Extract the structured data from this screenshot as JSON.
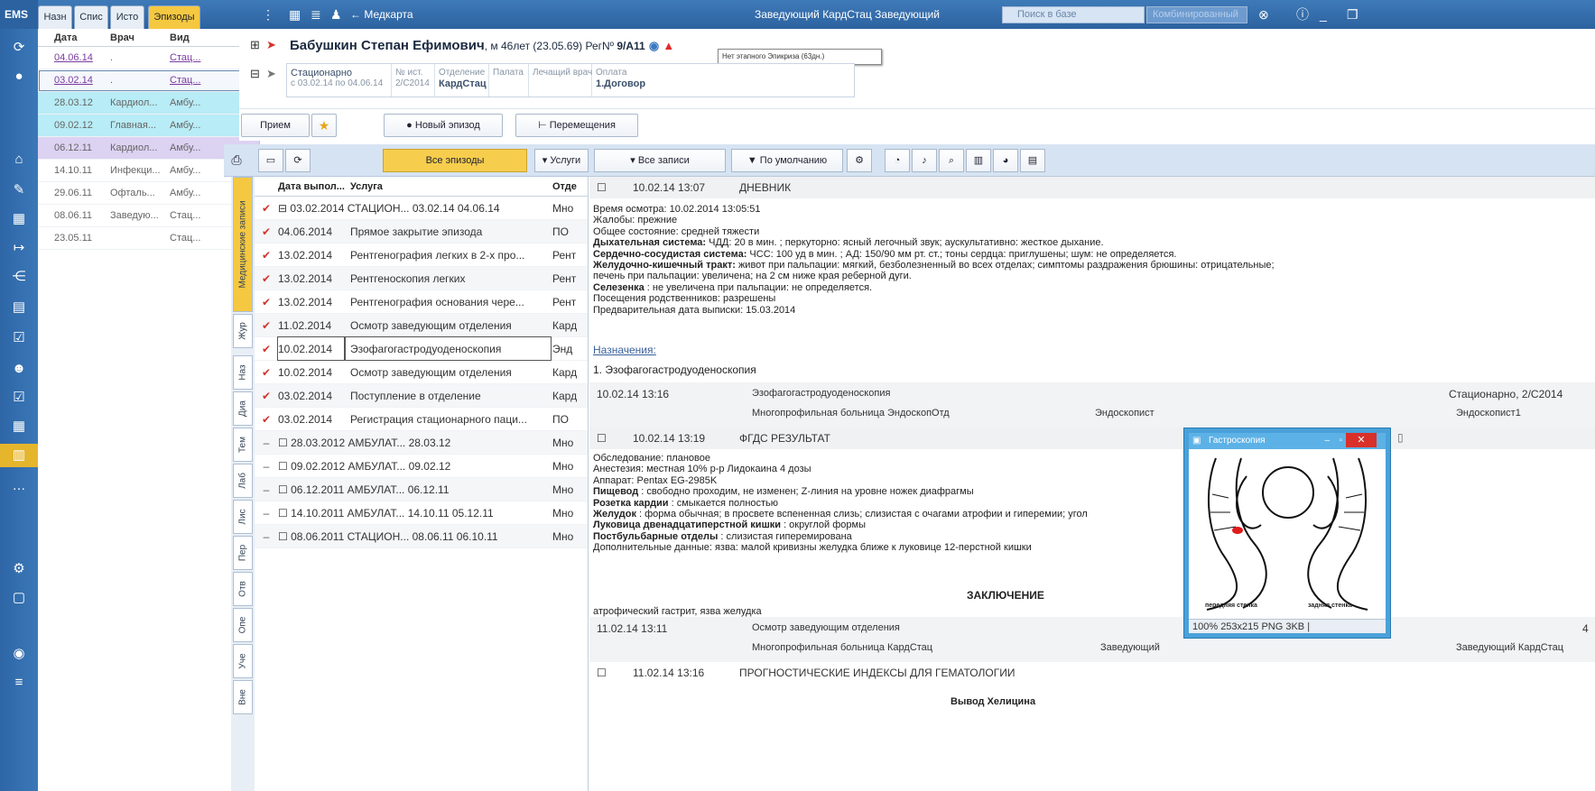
{
  "app": {
    "logo": "EMS"
  },
  "episode_tabs": [
    "Назн",
    "Спис",
    "Исто",
    "Эпизоды"
  ],
  "episode_list": {
    "headers": {
      "date": "Дата",
      "doctor": "Врач",
      "type": "Вид"
    },
    "rows": [
      {
        "date": "04.06.14",
        "doctor": ".",
        "type": "Стац..."
      },
      {
        "date": "03.02.14",
        "doctor": ".",
        "type": "Стац..."
      },
      {
        "date": "28.03.12",
        "doctor": "Кардиол...",
        "type": "Амбу..."
      },
      {
        "date": "09.02.12",
        "doctor": "Главная...",
        "type": "Амбу..."
      },
      {
        "date": "06.12.11",
        "doctor": "Кардиол...",
        "type": "Амбу..."
      },
      {
        "date": "14.10.11",
        "doctor": "Инфекци...",
        "type": "Амбу..."
      },
      {
        "date": "29.06.11",
        "doctor": "Офталь...",
        "type": "Амбу..."
      },
      {
        "date": "08.06.11",
        "doctor": "Заведую...",
        "type": "Стац..."
      },
      {
        "date": "23.05.11",
        "doctor": "",
        "type": "Стац..."
      }
    ]
  },
  "topbar": {
    "medcard": "Медкарта",
    "user": "Заведующий КардСтац Заведующий",
    "search_placeholder": "Поиск в базе",
    "combo": "Комбинированный"
  },
  "patient": {
    "name": "Бабушкин Степан Ефимович",
    "details": ", м 46лет (23.05.69) РегNº ",
    "reg": "9/А11",
    "tooltip": "Нет этапного Эпикриза (63дн.)",
    "card": {
      "type": "Стационарно",
      "period": "с 03.02.14 по 04.06.14",
      "num_label": "№ ист.",
      "num": "2/С2014",
      "dept_label": "Отделение",
      "dept": "КардСтац",
      "ward_label": "Палата",
      "doctor_label": "Лечащий врач",
      "pay_label": "Оплата",
      "pay": "1.Договор"
    }
  },
  "actions": {
    "reception": "Прием",
    "new_episode": "Новый эпизод",
    "transfers": "Перемещения"
  },
  "toolbar": {
    "all_episodes": "Все эпизоды",
    "services": "Услуги",
    "all_records": "Все записи",
    "default": "По умолчанию"
  },
  "vertical_tabs": [
    "Медицинские записи",
    "Жур",
    "Наз",
    "Диа",
    "Тем",
    "Лаб",
    "Лис",
    "Пер",
    "Отв",
    "Опе",
    "Уче",
    "Вне"
  ],
  "services": {
    "headers": {
      "date": "Дата выпол...",
      "service": "Услуга",
      "dept": "Отде"
    },
    "rows": [
      {
        "mark": "✔",
        "date": "",
        "service": "⊟ 03.02.2014  СТАЦИОН...  03.02.14   04.06.14",
        "dept": "Мно"
      },
      {
        "mark": "✔",
        "date": "04.06.2014",
        "service": "Прямое закрытие эпизода",
        "dept": "ПО"
      },
      {
        "mark": "✔",
        "date": "13.02.2014",
        "service": "Рентгенография легких в 2-х про...",
        "dept": "Рент"
      },
      {
        "mark": "✔",
        "date": "13.02.2014",
        "service": "Рентгеноскопия легких",
        "dept": "Рент"
      },
      {
        "mark": "✔",
        "date": "13.02.2014",
        "service": "Рентгенография основания чере...",
        "dept": "Рент"
      },
      {
        "mark": "✔",
        "date": "11.02.2014",
        "service": "Осмотр заведующим отделения",
        "dept": "Кард"
      },
      {
        "mark": "✔",
        "date": "10.02.2014",
        "service": "Эзофагогастродуоденоскопия",
        "dept": "Энд"
      },
      {
        "mark": "✔",
        "date": "10.02.2014",
        "service": "Осмотр заведующим отделения",
        "dept": "Кард"
      },
      {
        "mark": "✔",
        "date": "03.02.2014",
        "service": "Поступление в отделение",
        "dept": "Кард"
      },
      {
        "mark": "✔",
        "date": "03.02.2014",
        "service": "Регистрация стационарного паци...",
        "dept": "ПО"
      },
      {
        "mark": "–",
        "date": "",
        "service": "☐ 28.03.2012  АМБУЛАТ...  28.03.12",
        "dept": "Мно"
      },
      {
        "mark": "–",
        "date": "",
        "service": "☐ 09.02.2012  АМБУЛАТ...  09.02.12",
        "dept": "Мно"
      },
      {
        "mark": "–",
        "date": "",
        "service": "☐ 06.12.2011  АМБУЛАТ...  06.12.11",
        "dept": "Мно"
      },
      {
        "mark": "–",
        "date": "",
        "service": "☐ 14.10.2011  АМБУЛАТ...  14.10.11   05.12.11",
        "dept": "Мно"
      },
      {
        "mark": "–",
        "date": "",
        "service": "☐ 08.06.2011  СТАЦИОН...  08.06.11   06.10.11",
        "dept": "Мно"
      }
    ]
  },
  "records": {
    "r1": {
      "datetime": "10.02.14 13:07",
      "title": "ДНЕВНИК"
    },
    "diary": [
      {
        "k": "",
        "t": "Время осмотра: 10.02.2014 13:05:51"
      },
      {
        "k": "",
        "t": "Жалобы: прежние"
      },
      {
        "k": "",
        "t": "Общее состояние: средней тяжести"
      },
      {
        "k": "Дыхательная система:",
        "t": " ЧДД: 20 в мин. ; перкуторно: ясный легочный звук; аускультативно: жесткое дыхание."
      },
      {
        "k": "Сердечно-сосудистая система:",
        "t": " ЧСС: 100 уд в мин. ; АД: 150/90 мм рт. ст.; тоны сердца: приглушены; шум: не определяется."
      },
      {
        "k": "Желудочно-кишечный тракт:",
        "t": " живот при пальпации: мягкий, безболезненный во всех отделах; симптомы раздражения брюшины: отрицательные;"
      },
      {
        "k": "",
        "t": "печень при пальпации: увеличена; на 2 см ниже края реберной дуги."
      },
      {
        "k": "Селезенка",
        "t": " : не увеличена при пальпации: не определяется."
      },
      {
        "k": "",
        "t": "Посещения родственников: разрешены"
      },
      {
        "k": "",
        "t": "Предварительная дата выписки: 15.03.2014"
      }
    ],
    "prescriptions_label": "Назначения:",
    "prescription_1": "1. Эзофагогастродуоденоскопия",
    "block1": {
      "datetime": "10.02.14 13:16",
      "service": "Эзофагогастродуоденоскопия",
      "place": "Стационарно, 2/С2014",
      "org": "Многопрофильная больница   ЭндоскопОтд",
      "role": "Эндоскопист",
      "doctor": "Эндоскопист1"
    },
    "r2": {
      "datetime": "10.02.14 13:19",
      "title": "ФГДС РЕЗУЛЬТАТ"
    },
    "fgds": [
      {
        "k": "",
        "t": "Обследование: плановое"
      },
      {
        "k": "",
        "t": "Анестезия: местная 10% р-р Лидокаина 4 дозы"
      },
      {
        "k": "",
        "t": "Аппарат: Pentax EG-2985K"
      },
      {
        "k": "Пищевод",
        "t": " : свободно проходим, не изменен; Z-линия на уровне ножек диафрагмы"
      },
      {
        "k": "Розетка кардии",
        "t": " : смыкается полностью"
      },
      {
        "k": "Желудок",
        "t": " : форма обычная; в просвете вспененная слизь; слизистая с очагами атрофии и гиперемии; угол"
      },
      {
        "k": "Луковица двенадцатиперстной кишки",
        "t": " : округлой формы"
      },
      {
        "k": "Постбульбарные отделы",
        "t": " : слизистая гиперемирована"
      },
      {
        "k": "",
        "t": "Дополнительные данные: язва: малой кривизны желудка ближе к луковице 12-перстной кишки"
      }
    ],
    "conclusion_title": "ЗАКЛЮЧЕНИЕ",
    "conclusion": "атрофический гастрит, язва желудка",
    "block2": {
      "datetime": "11.02.14 13:11",
      "service": "Осмотр заведующим отделения",
      "suffix": "4",
      "org": "Многопрофильная больница   КардСтац",
      "role": "Заведующий",
      "doctor": "Заведующий КардСтац"
    },
    "r3": {
      "datetime": "11.02.14 13:16",
      "title": "ПРОГНОСТИЧЕСКИЕ ИНДЕКСЫ ДЛЯ ГЕМАТОЛОГИИ"
    },
    "footer_cut": "Вывод Хелицина"
  },
  "image_window": {
    "title": "Гастроскопия",
    "close": "✕",
    "label_front": "передняя стенка",
    "label_back": "задняя стенка",
    "status": "100%   253x215   PNG   3KB   |"
  }
}
